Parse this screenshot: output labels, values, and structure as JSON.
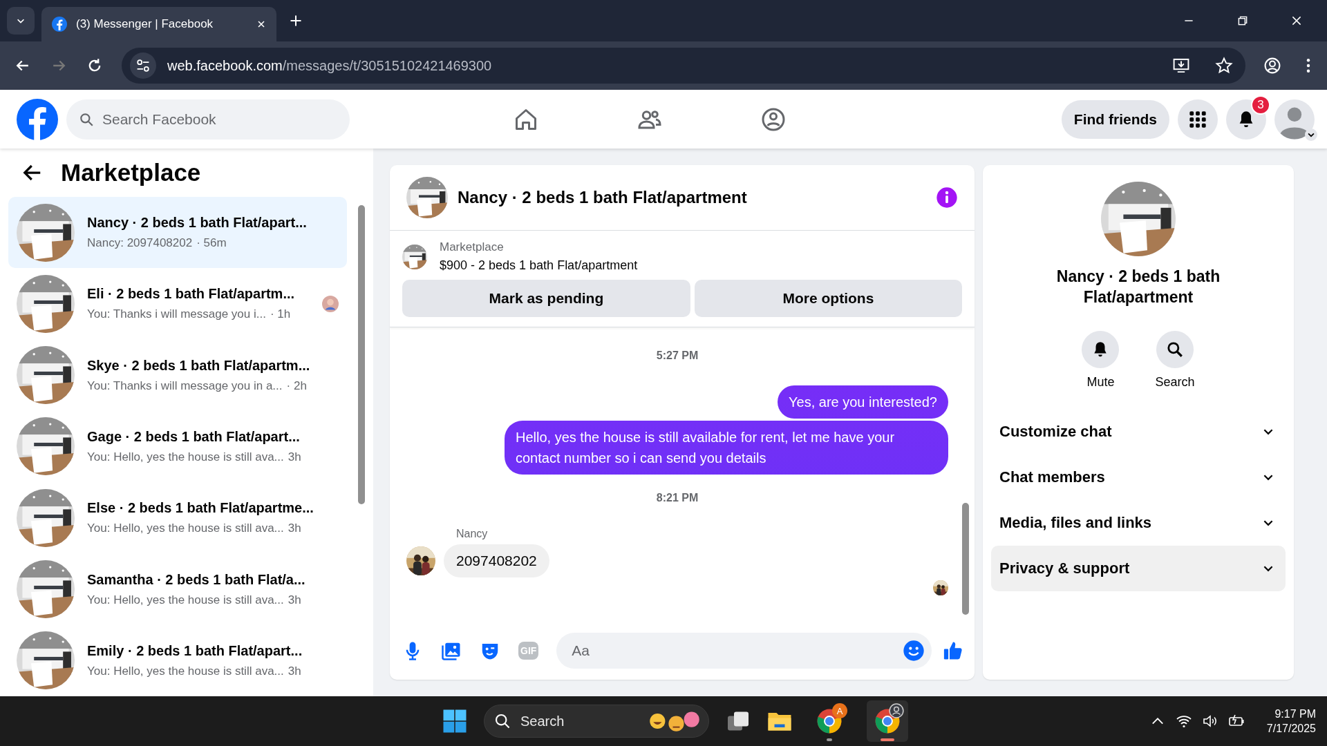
{
  "browser": {
    "tab_title": "(3) Messenger | Facebook",
    "url_domain": "web.facebook.com",
    "url_path": "/messages/t/30515102421469300"
  },
  "header": {
    "search_placeholder": "Search Facebook",
    "find_friends": "Find friends",
    "notification_count": "3"
  },
  "sidebar": {
    "title": "Marketplace",
    "conversations": [
      {
        "title": "Nancy · 2 beds 1 bath Flat/apart...",
        "preview": "Nancy: 2097408202",
        "time": "· 56m",
        "selected": true,
        "read_receipt": false
      },
      {
        "title": "Eli · 2 beds 1 bath Flat/apartm...",
        "preview": "You: Thanks i will message you i...",
        "time": "· 1h",
        "selected": false,
        "read_receipt": true
      },
      {
        "title": "Skye · 2 beds 1 bath Flat/apartm...",
        "preview": "You: Thanks i will message you in a...",
        "time": "· 2h",
        "selected": false,
        "read_receipt": false
      },
      {
        "title": "Gage · 2 beds 1 bath Flat/apart...",
        "preview": "You: Hello, yes the house is still ava...",
        "time": "3h",
        "selected": false,
        "read_receipt": false
      },
      {
        "title": "Else · 2 beds 1 bath Flat/apartme...",
        "preview": "You: Hello, yes the house is still ava...",
        "time": "3h",
        "selected": false,
        "read_receipt": false
      },
      {
        "title": "Samantha · 2 beds 1 bath Flat/a...",
        "preview": "You: Hello, yes the house is still ava...",
        "time": "3h",
        "selected": false,
        "read_receipt": false
      },
      {
        "title": "Emily · 2 beds 1 bath Flat/apart...",
        "preview": "You: Hello, yes the house is still ava...",
        "time": "3h",
        "selected": false,
        "read_receipt": false
      }
    ]
  },
  "chat": {
    "title": "Nancy · 2 beds 1 bath Flat/apartment",
    "listing": {
      "label": "Marketplace",
      "text": "$900 - 2 beds 1 bath Flat/apartment"
    },
    "buttons": [
      "Mark as pending",
      "More options"
    ],
    "messages": [
      {
        "kind": "time",
        "text": "5:27 PM"
      },
      {
        "kind": "sent",
        "text": "Yes, are you interested?"
      },
      {
        "kind": "sent",
        "text": "Hello, yes the house is still available for rent, let me have your contact number so i can send you details"
      },
      {
        "kind": "time",
        "text": "8:21 PM"
      },
      {
        "kind": "received",
        "sender": "Nancy",
        "text": "2097408202"
      }
    ],
    "composer": {
      "placeholder": "Aa",
      "gif_label": "GIF"
    }
  },
  "details": {
    "title": "Nancy · 2 beds 1 bath Flat/apartment",
    "actions": [
      {
        "kind": "mute",
        "label": "Mute"
      },
      {
        "kind": "search",
        "label": "Search"
      }
    ],
    "sections": [
      {
        "label": "Customize chat",
        "highlighted": false
      },
      {
        "label": "Chat members",
        "highlighted": false
      },
      {
        "label": "Media, files and links",
        "highlighted": false
      },
      {
        "label": "Privacy & support",
        "highlighted": true
      }
    ]
  },
  "taskbar": {
    "search_placeholder": "Search",
    "chrome_badge": "A",
    "time": "9:17 PM",
    "date": "7/17/2025"
  }
}
